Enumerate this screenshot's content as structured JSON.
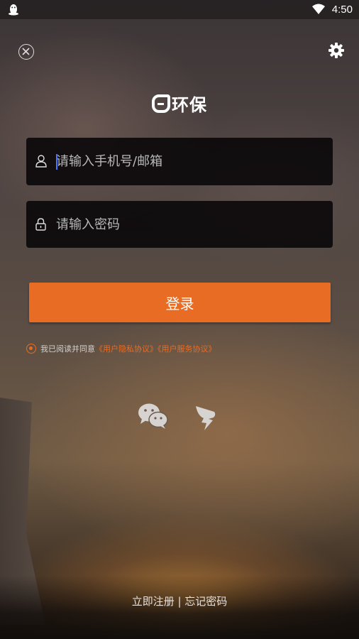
{
  "status_bar": {
    "time": "4:50",
    "app_icon": "qq-penguin-icon",
    "signal_icon": "wifi-icon"
  },
  "header": {
    "close_icon": "close-circle-icon",
    "settings_icon": "gear-icon"
  },
  "logo": {
    "text": "环保",
    "mark": "a"
  },
  "form": {
    "phone_placeholder": "请输入手机号/邮箱",
    "password_placeholder": "请输入密码",
    "phone_value": "",
    "password_value": "",
    "login_label": "登录"
  },
  "agreement": {
    "prefix": "我已阅读并同意",
    "privacy_link": "《用户隐私协议》",
    "service_link": "《用户服务协议》"
  },
  "social": {
    "wechat_icon": "wechat-icon",
    "other_icon": "dingtalk-icon"
  },
  "footer": {
    "register": "立即注册",
    "separator": " | ",
    "forgot": "忘记密码"
  },
  "colors": {
    "accent": "#e96c25",
    "field_bg": "#080608"
  }
}
